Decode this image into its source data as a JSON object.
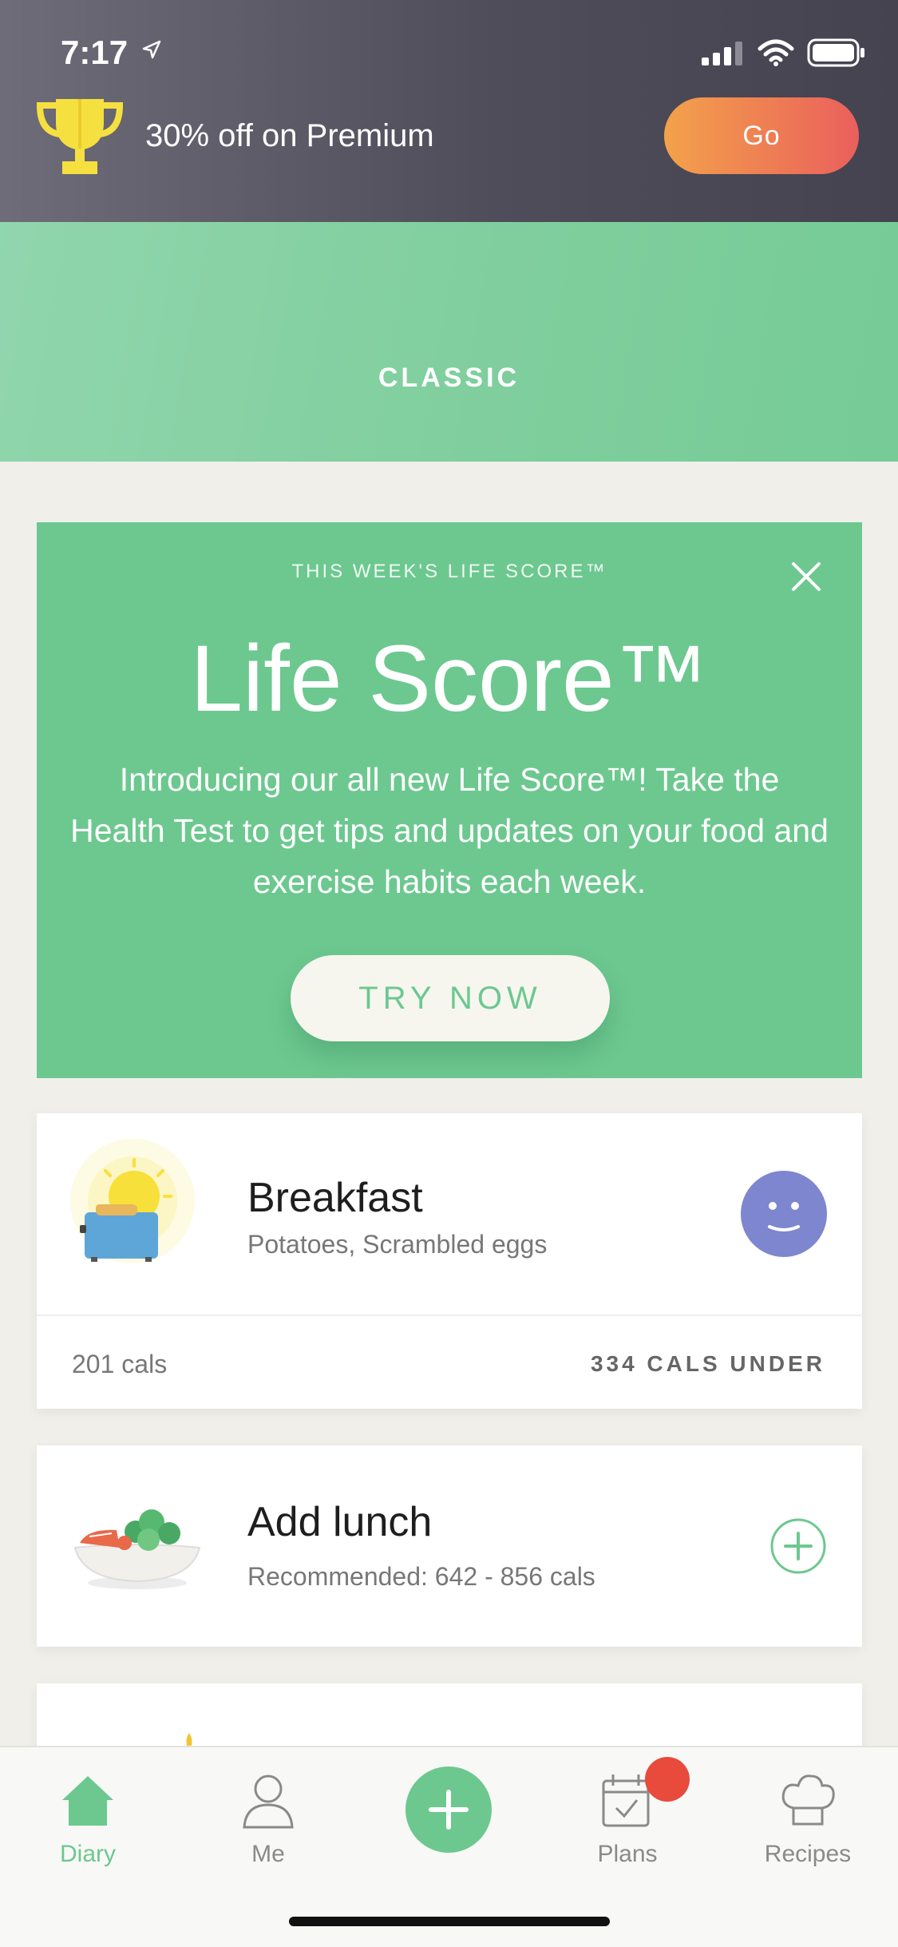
{
  "status_bar": {
    "time": "7:17"
  },
  "promo": {
    "text": "30% off on Premium",
    "go_label": "Go"
  },
  "header": {
    "label": "CLASSIC"
  },
  "life_score": {
    "kicker": "THIS WEEK'S LIFE SCORE™",
    "title": "Life Score™",
    "description": "Introducing our all new Life Score™! Take the Health Test to get tips and updates on your food and exercise habits each week.",
    "cta": "TRY NOW"
  },
  "breakfast": {
    "title": "Breakfast",
    "items": "Potatoes, Scrambled eggs",
    "cals": "201 cals",
    "status": "334 CALS UNDER"
  },
  "lunch": {
    "title": "Add lunch",
    "recommended": "Recommended: 642 - 856  cals"
  },
  "tabs": [
    {
      "label": "Diary",
      "icon": "home-icon",
      "active": true
    },
    {
      "label": "Me",
      "icon": "person-icon"
    },
    {
      "label": "",
      "icon": "plus-icon"
    },
    {
      "label": "Plans",
      "icon": "calendar-check-icon"
    },
    {
      "label": "Recipes",
      "icon": "chef-hat-icon"
    }
  ],
  "colors": {
    "accent": "#6cc88f",
    "promo_gradient_start": "#f3a24b",
    "promo_gradient_end": "#ea5f5c",
    "badge": "#e84b3c"
  }
}
